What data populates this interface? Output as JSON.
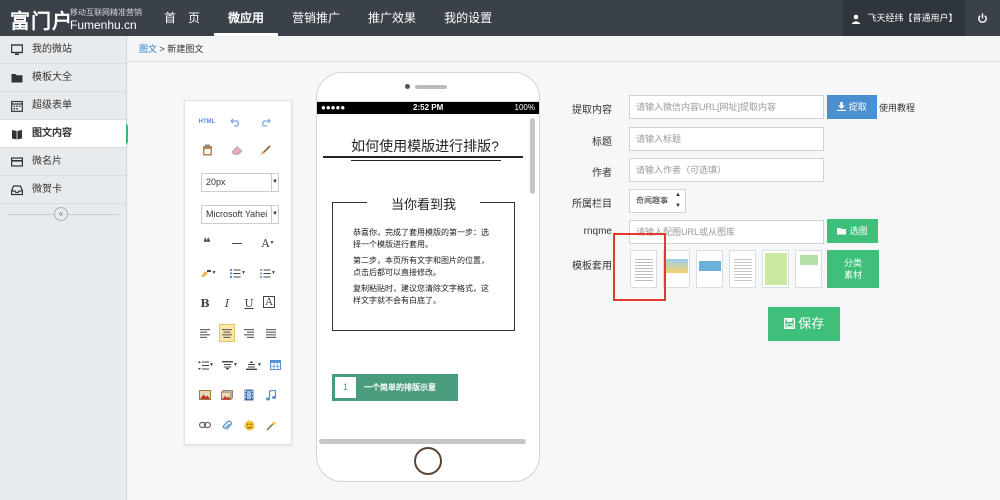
{
  "app": {
    "logo_main": "富门户",
    "logo_sub1": "移动互联网精准营销",
    "logo_sub2": "Fumenhu.cn"
  },
  "nav": [
    {
      "label": "首　页",
      "active": false
    },
    {
      "label": "微应用",
      "active": true
    },
    {
      "label": "营销推广",
      "active": false
    },
    {
      "label": "推广效果",
      "active": false
    },
    {
      "label": "我的设置",
      "active": false
    }
  ],
  "user": {
    "label": "飞天经纬【普通用户】"
  },
  "sidebar": {
    "items": [
      {
        "label": "我的微站",
        "icon": "monitor-icon"
      },
      {
        "label": "模板大全",
        "icon": "folder-icon"
      },
      {
        "label": "超级表单",
        "icon": "calendar-icon"
      },
      {
        "label": "图文内容",
        "icon": "book-icon",
        "active": true
      },
      {
        "label": "微名片",
        "icon": "card-icon"
      },
      {
        "label": "微贺卡",
        "icon": "inbox-icon"
      }
    ],
    "collapse": "«"
  },
  "breadcrumb": {
    "parent": "图文",
    "separator": ">",
    "current": "新建图文"
  },
  "toolbar": {
    "html": "HTML",
    "font_size": "20px",
    "font_family": "Microsoft Yahei",
    "bold": "B",
    "italic": "I",
    "underline": "U",
    "font_a": "A"
  },
  "phone": {
    "status_signal": "●●●●● ",
    "status_time": "2:52 PM",
    "status_right": "100%",
    "title": "如何使用模版进行排版?",
    "box_title": "当你看到我",
    "p1": "恭喜你，完成了套用模版的第一步：选择一个模版进行套用。",
    "p2": "第二步，本页所有文字和图片的位置，点击后都可以直接修改。",
    "p3": "复制粘贴时，建议您清除文字格式，这样文字就不会有白底了。",
    "step_num": "1",
    "step_text": "一个简单的排版示意"
  },
  "form": {
    "extract_label": "提取内容",
    "extract_placeholder": "请输入微信内容URL[网址]提取内容",
    "extract_button": "提取",
    "help_link": "使用教程",
    "title_label": "标题",
    "title_placeholder": "请输入标题",
    "author_label": "作者",
    "author_placeholder": "请输入作者（可选填）",
    "column_label": "所属栏目",
    "column_value": "奇闻趣事",
    "image_label": "rnqme",
    "image_placeholder": "请输入配图URL或从图库",
    "image_button": "选图",
    "template_label": "模板套用",
    "category_button_1": "分类",
    "category_button_2": "素材",
    "save_button": "保存"
  },
  "colors": {
    "topbar": "#3a4149",
    "accent_green": "#3ec07a",
    "accent_blue": "#4a8fd0",
    "highlight_red": "#e23b2e"
  }
}
